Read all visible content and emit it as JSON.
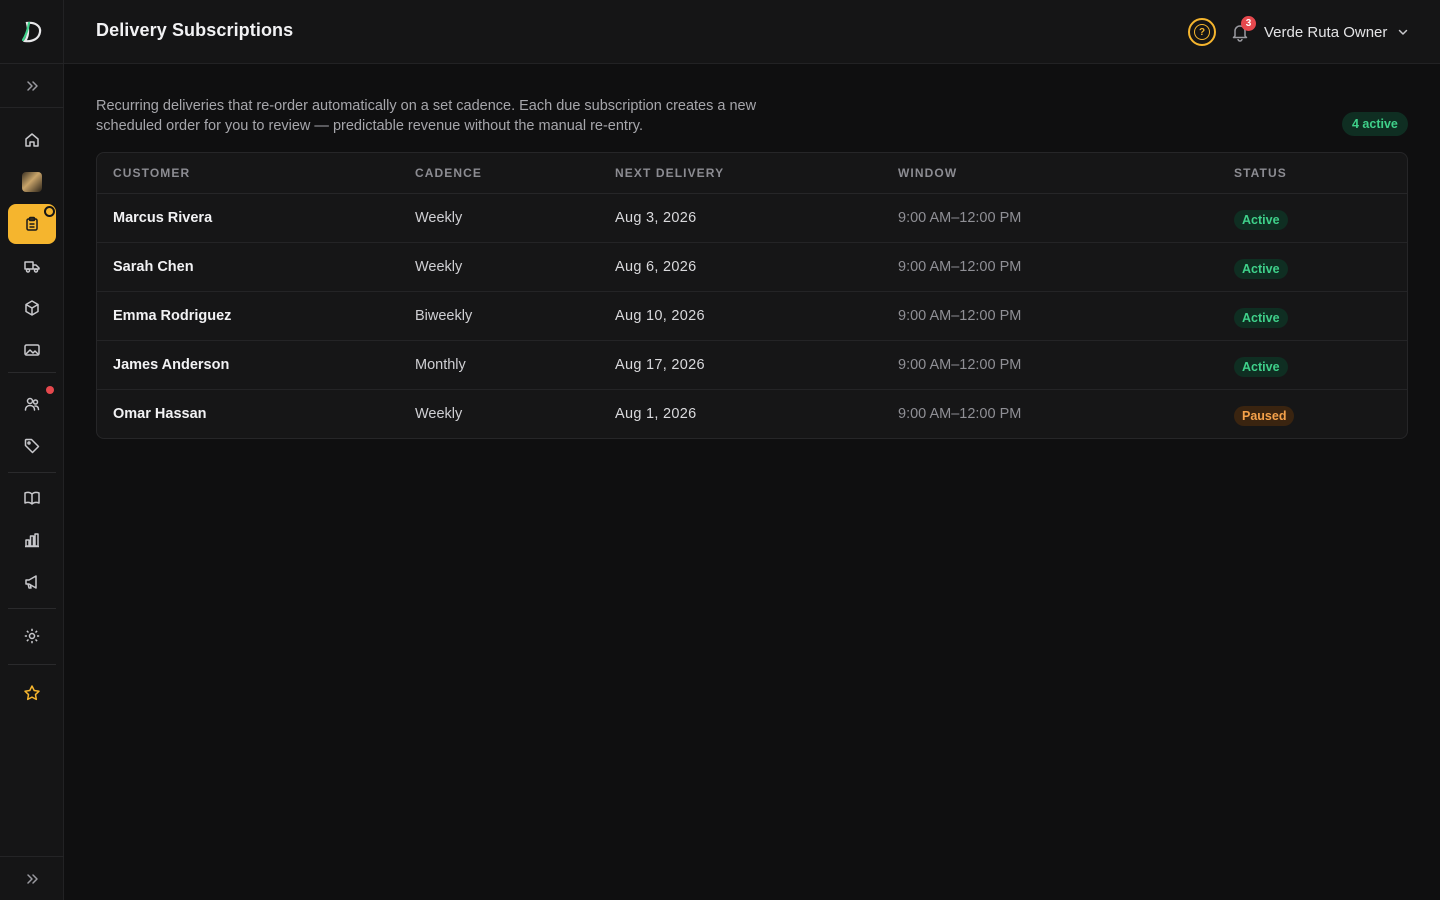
{
  "header": {
    "title": "Delivery Subscriptions",
    "notification_count": "3",
    "user_label": "Verde Ruta Owner"
  },
  "sidebar": {
    "items": [
      {
        "icon": "home-icon"
      },
      {
        "icon": "photo-thumbnail"
      },
      {
        "icon": "clipboard-icon",
        "active": true
      },
      {
        "icon": "truck-icon"
      },
      {
        "icon": "box-icon"
      },
      {
        "icon": "image-icon"
      },
      {
        "icon": "users-icon"
      },
      {
        "icon": "tag-icon"
      },
      {
        "icon": "book-icon"
      },
      {
        "icon": "bar-chart-icon"
      },
      {
        "icon": "megaphone-icon"
      },
      {
        "icon": "gear-icon"
      },
      {
        "icon": "star-icon"
      }
    ]
  },
  "intro": {
    "text": "Recurring deliveries that re-order automatically on a set cadence. Each due subscription creates a new scheduled order for you to review — predictable revenue without the manual re-entry.",
    "active_count_label": "4 active"
  },
  "table": {
    "columns": [
      "CUSTOMER",
      "CADENCE",
      "NEXT DELIVERY",
      "WINDOW",
      "STATUS"
    ],
    "rows": [
      {
        "customer": "Marcus Rivera",
        "cadence": "Weekly",
        "next_delivery": "Aug 3, 2026",
        "window": "9:00 AM–12:00 PM",
        "status": "Active"
      },
      {
        "customer": "Sarah Chen",
        "cadence": "Weekly",
        "next_delivery": "Aug 6, 2026",
        "window": "9:00 AM–12:00 PM",
        "status": "Active"
      },
      {
        "customer": "Emma Rodriguez",
        "cadence": "Biweekly",
        "next_delivery": "Aug 10, 2026",
        "window": "9:00 AM–12:00 PM",
        "status": "Active"
      },
      {
        "customer": "James Anderson",
        "cadence": "Monthly",
        "next_delivery": "Aug 17, 2026",
        "window": "9:00 AM–12:00 PM",
        "status": "Active"
      },
      {
        "customer": "Omar Hassan",
        "cadence": "Weekly",
        "next_delivery": "Aug 1, 2026",
        "window": "9:00 AM–12:00 PM",
        "status": "Paused"
      }
    ]
  },
  "colors": {
    "accent": "#f5b52e",
    "active_status": "#3fd08a",
    "paused_status": "#f5a14a",
    "notification": "#e5484d"
  }
}
